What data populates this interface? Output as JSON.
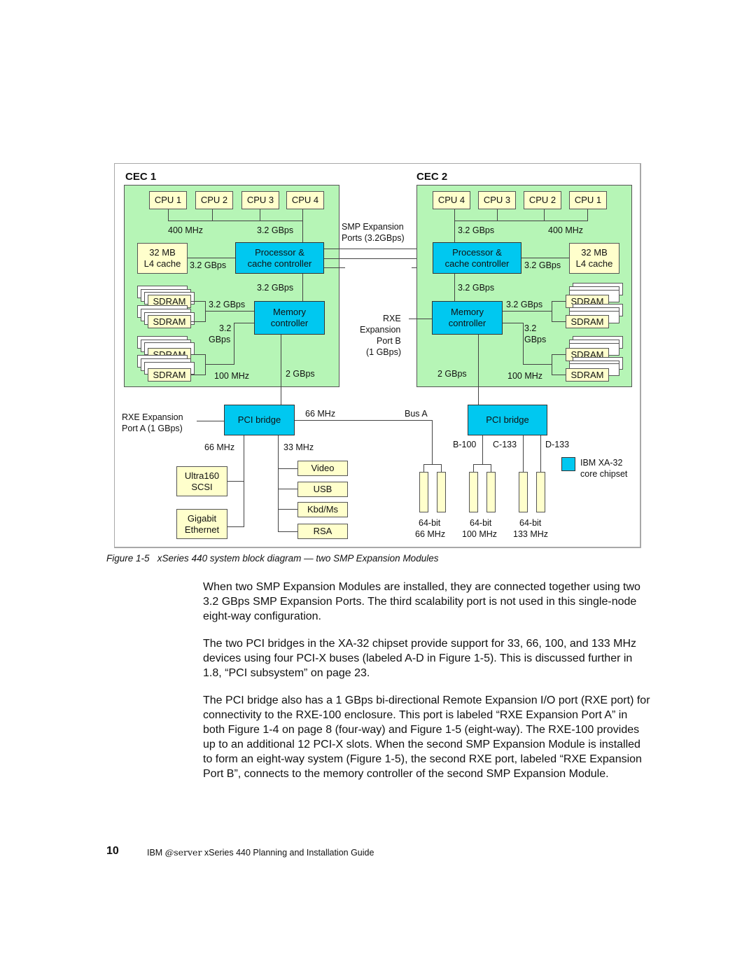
{
  "figure": {
    "cec1": {
      "title": "CEC 1",
      "cpus": [
        "CPU 1",
        "CPU 2",
        "CPU 3",
        "CPU 4"
      ],
      "cpu_bus_speed": "400 MHz",
      "cpu_bus_bandwidth": "3.2 GBps",
      "l4_cache": [
        "32 MB",
        "L4 cache"
      ],
      "l4_link": "3.2 GBps",
      "proc_ctrl": [
        "Processor &",
        "cache controller"
      ],
      "proc_mem_link": "3.2 GBps",
      "sdram": [
        "SDRAM",
        "SDRAM",
        "SDRAM",
        "SDRAM"
      ],
      "sdram_link_top": "3.2 GBps",
      "sdram_link_bottom": [
        "3.2",
        "GBps"
      ],
      "sdram_speed": "100 MHz",
      "mem_ctrl": [
        "Memory",
        "controller"
      ],
      "mem_pci_link": "2 GBps"
    },
    "cec2": {
      "title": "CEC 2",
      "cpus": [
        "CPU 4",
        "CPU 3",
        "CPU 2",
        "CPU 1"
      ],
      "cpu_bus_speed": "400 MHz",
      "cpu_bus_bandwidth": "3.2 GBps",
      "l4_cache": [
        "32 MB",
        "L4 cache"
      ],
      "l4_link": "3.2 GBps",
      "proc_ctrl": [
        "Processor &",
        "cache controller"
      ],
      "proc_mem_link": "3.2 GBps",
      "sdram": [
        "SDRAM",
        "SDRAM",
        "SDRAM",
        "SDRAM"
      ],
      "sdram_link_top": "3.2 GBps",
      "sdram_link_bottom": [
        "3.2",
        "GBps"
      ],
      "sdram_speed": "100 MHz",
      "mem_ctrl": [
        "Memory",
        "controller"
      ],
      "mem_pci_link": "2 GBps"
    },
    "smp_ports": [
      "SMP Expansion",
      "Ports (3.2GBps)"
    ],
    "rxe_b": [
      "RXE",
      "Expansion",
      "Port B",
      "(1 GBps)"
    ],
    "rxe_a": [
      "RXE Expansion",
      "Port A (1 GBps)"
    ],
    "pci_bridge_1": {
      "label": "PCI bridge",
      "bus_a_speed": "66 MHz",
      "bus_a_label": "Bus A",
      "left_link": "66 MHz",
      "right_link": "33 MHz",
      "left_devices": [
        [
          "Ultra160",
          "SCSI"
        ],
        [
          "Gigabit",
          "Ethernet"
        ]
      ],
      "right_devices": [
        "Video",
        "USB",
        "Kbd/Ms",
        "RSA"
      ]
    },
    "pci_bridge_2": {
      "label": "PCI bridge",
      "buses": [
        "B-100",
        "C-133",
        "D-133"
      ]
    },
    "slot_groups": [
      [
        "64-bit",
        "66 MHz"
      ],
      [
        "64-bit",
        "100 MHz"
      ],
      [
        "64-bit",
        "133 MHz"
      ]
    ],
    "legend": {
      "label": [
        "IBM XA-32",
        "core chipset"
      ],
      "color": "#00c8f0"
    },
    "colors": {
      "cec_background": "#b6f5b6",
      "component": "#ffffcc",
      "chipset": "#00c8f0"
    }
  },
  "caption": {
    "number": "Figure 1-5",
    "text": "xSeries 440 system block diagram — two SMP Expansion Modules"
  },
  "paragraphs": [
    "When two SMP Expansion Modules are installed, they are connected together using two 3.2 GBps SMP Expansion Ports. The third scalability port is not used in this single-node eight-way configuration.",
    "The two PCI bridges in the XA-32 chipset provide support for 33, 66, 100, and 133 MHz devices using four PCI-X buses (labeled A-D in Figure 1-5). This is discussed further in 1.8, “PCI subsystem” on page 23.",
    "The PCI bridge also has a 1 GBps bi-directional Remote Expansion I/O port (RXE port) for connectivity to the RXE-100 enclosure. This port is labeled “RXE Expansion Port A” in both Figure 1-4 on page 8 (four-way) and Figure 1-5 (eight-way). The RXE-100 provides up to an additional 12 PCI-X slots. When the second SMP Expansion Module is installed to form an eight-way system (Figure 1-5), the second RXE port, labeled “RXE Expansion Port B”, connects to the memory controller of the second SMP Expansion Module."
  ],
  "footer": {
    "page_number": "10",
    "prefix": "IBM ",
    "eserver_at": "@",
    "eserver_word": "server",
    "title": " xSeries 440 Planning and Installation Guide"
  }
}
